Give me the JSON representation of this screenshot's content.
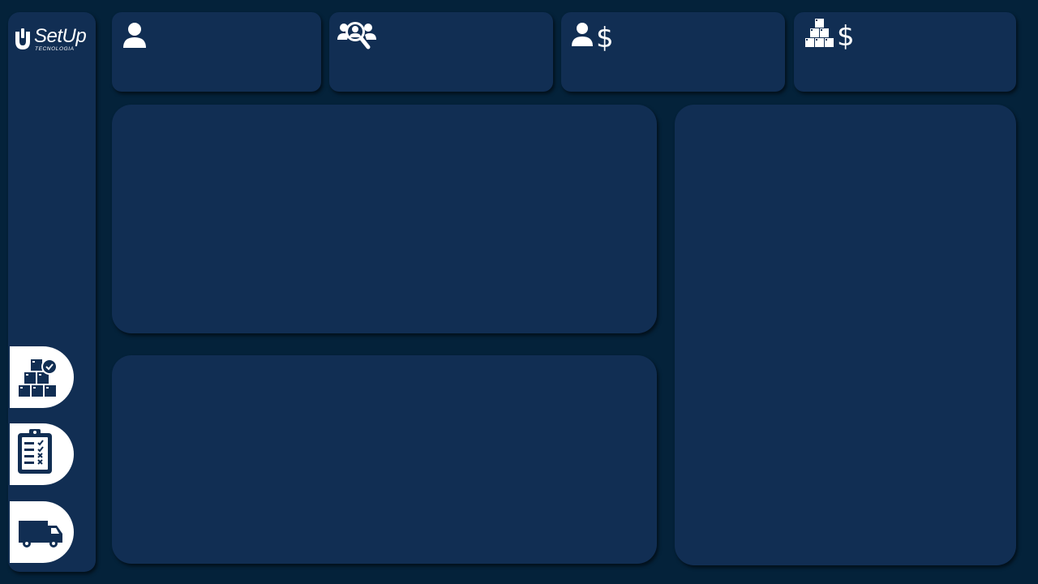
{
  "brand": {
    "name": "SetUp",
    "tagline": "TECNOLOGIA"
  },
  "colors": {
    "background": "#04223a",
    "card": "#112e53",
    "icon": "#ffffff",
    "button": "#ffffff",
    "button_icon": "#112e53"
  },
  "sidebar": {
    "buttons": [
      {
        "id": "stock-check",
        "icon": "boxes-check-icon"
      },
      {
        "id": "checklist",
        "icon": "clipboard-checklist-icon"
      },
      {
        "id": "delivery",
        "icon": "truck-icon"
      }
    ]
  },
  "kpis": [
    {
      "id": "customers",
      "icon": "user-icon",
      "label": "",
      "value": ""
    },
    {
      "id": "prospects",
      "icon": "users-search-icon",
      "label": "",
      "value": ""
    },
    {
      "id": "customer-revenue",
      "icon": "user-dollar-icon",
      "label": "",
      "value": ""
    },
    {
      "id": "stock-value",
      "icon": "boxes-dollar-icon",
      "label": "",
      "value": ""
    }
  ],
  "panels": [
    {
      "id": "panel-top-left",
      "content": ""
    },
    {
      "id": "panel-bottom-left",
      "content": ""
    },
    {
      "id": "panel-right",
      "content": ""
    }
  ]
}
